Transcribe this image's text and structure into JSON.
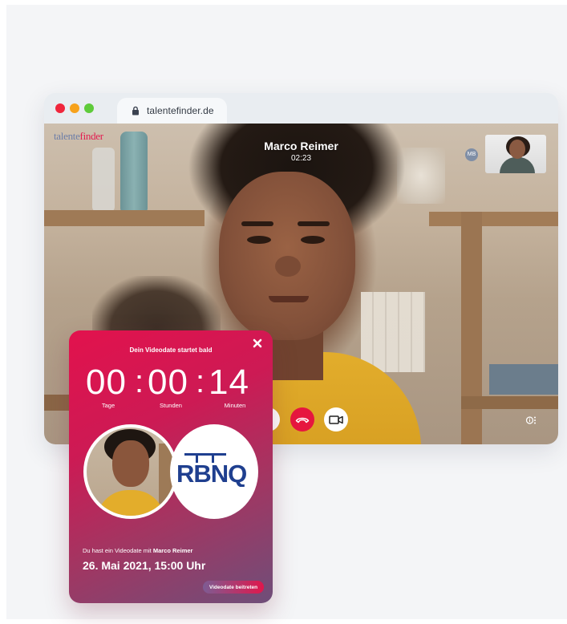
{
  "browser": {
    "url": "talentefinder.de"
  },
  "call": {
    "brand_part1": "talente",
    "brand_part2": "finder",
    "caller_name": "Marco Reimer",
    "duration": "02:23",
    "participant_initials": "MB"
  },
  "controls": [
    {
      "name": "hang-up",
      "icon": "phone-hangup-icon",
      "color": "#e6163f"
    },
    {
      "name": "camera",
      "icon": "video-camera-icon"
    },
    {
      "name": "more",
      "icon": "info-more-icon"
    }
  ],
  "popup": {
    "title": "Dein Videodate startet bald",
    "countdown": {
      "days": "00",
      "hours": "00",
      "minutes": "14",
      "separator": ":",
      "days_label": "Tage",
      "hours_label": "Stunden",
      "minutes_label": "Minuten"
    },
    "company_logo_text": "RBNQ",
    "description_prefix": "Du hast ein Videodate mit",
    "description_name": "Marco Reimer",
    "date": "26. Mai 2021, 15:00 Uhr",
    "join_label": "Videodate beitreten"
  },
  "colors": {
    "accent": "#e31b4f",
    "brand_blue": "#1f3f8f",
    "traffic_red": "#f0263c",
    "traffic_orange": "#f7a21b",
    "traffic_green": "#5ecb3a"
  }
}
